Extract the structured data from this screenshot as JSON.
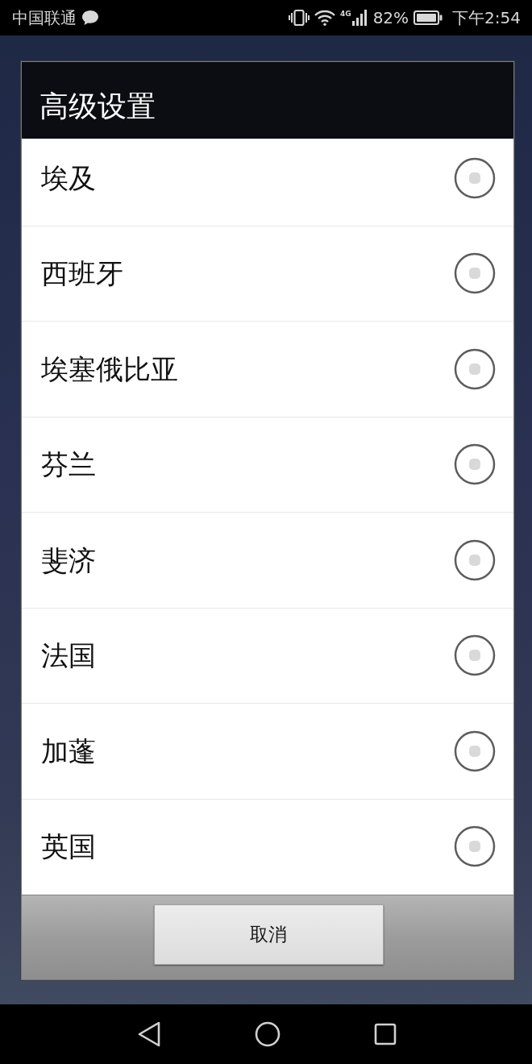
{
  "status_bar": {
    "carrier": "中国联通",
    "network_type": "4G",
    "battery_percent": "82%",
    "time": "下午2:54"
  },
  "dialog": {
    "title": "高级设置",
    "options": [
      {
        "label": "埃及",
        "selected": false
      },
      {
        "label": "西班牙",
        "selected": false
      },
      {
        "label": "埃塞俄比亚",
        "selected": false
      },
      {
        "label": "芬兰",
        "selected": false
      },
      {
        "label": "斐济",
        "selected": false
      },
      {
        "label": "法国",
        "selected": false
      },
      {
        "label": "加蓬",
        "selected": false
      },
      {
        "label": "英国",
        "selected": false
      }
    ],
    "buttons": [
      {
        "label": "取消"
      }
    ]
  }
}
